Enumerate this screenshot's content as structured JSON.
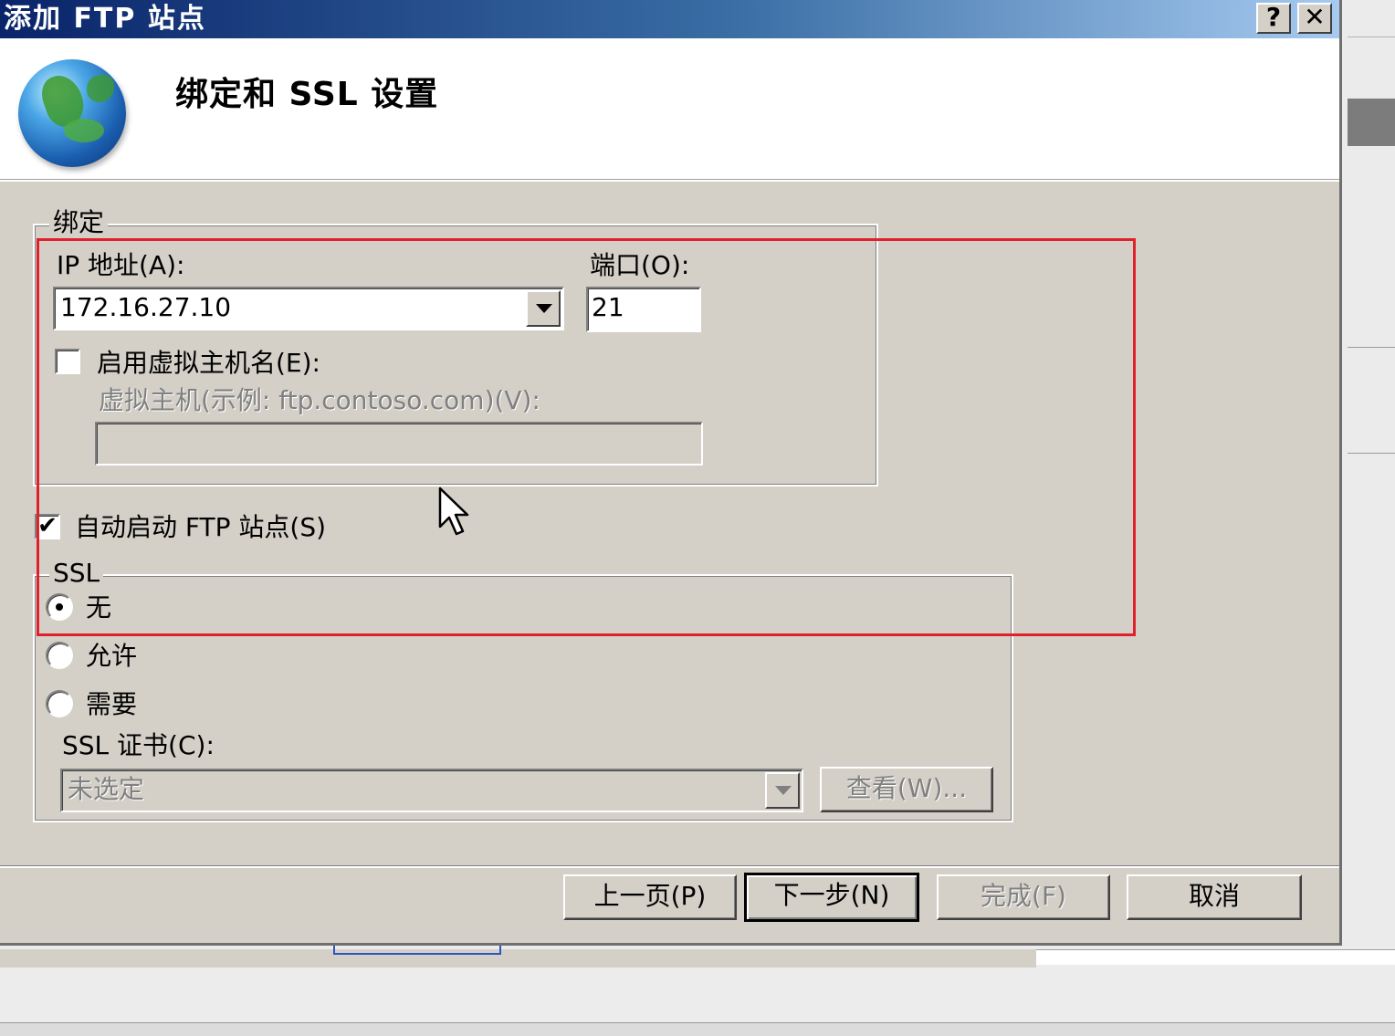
{
  "window": {
    "title": "添加 FTP 站点",
    "help_label": "?",
    "close_label": "✕"
  },
  "header": {
    "heading": "绑定和 SSL 设置",
    "icon": "globe-icon"
  },
  "binding": {
    "group_label": "绑定",
    "ip_label": "IP 地址(A):",
    "ip_value": "172.16.27.10",
    "port_label": "端口(O):",
    "port_value": "21",
    "vhost_checkbox_label": "启用虚拟主机名(E):",
    "vhost_checked": false,
    "vhost_field_label": "虚拟主机(示例: ftp.contoso.com)(V):",
    "vhost_value": ""
  },
  "autostart": {
    "label": "自动启动 FTP 站点(S)",
    "checked": true,
    "check_mark": "✔"
  },
  "ssl": {
    "group_label": "SSL",
    "options": [
      {
        "label": "无",
        "selected": true
      },
      {
        "label": "允许",
        "selected": false
      },
      {
        "label": "需要",
        "selected": false
      }
    ],
    "cert_label": "SSL 证书(C):",
    "cert_value": "未选定",
    "view_button": "查看(W)..."
  },
  "footer": {
    "prev": "上一页(P)",
    "next": "下一步(N)",
    "finish": "完成(F)",
    "cancel": "取消"
  },
  "colors": {
    "highlight": "#e0202b",
    "dialog_bg": "#d4d0c8",
    "title_start": "#0a246a",
    "title_end": "#a6caf0"
  }
}
